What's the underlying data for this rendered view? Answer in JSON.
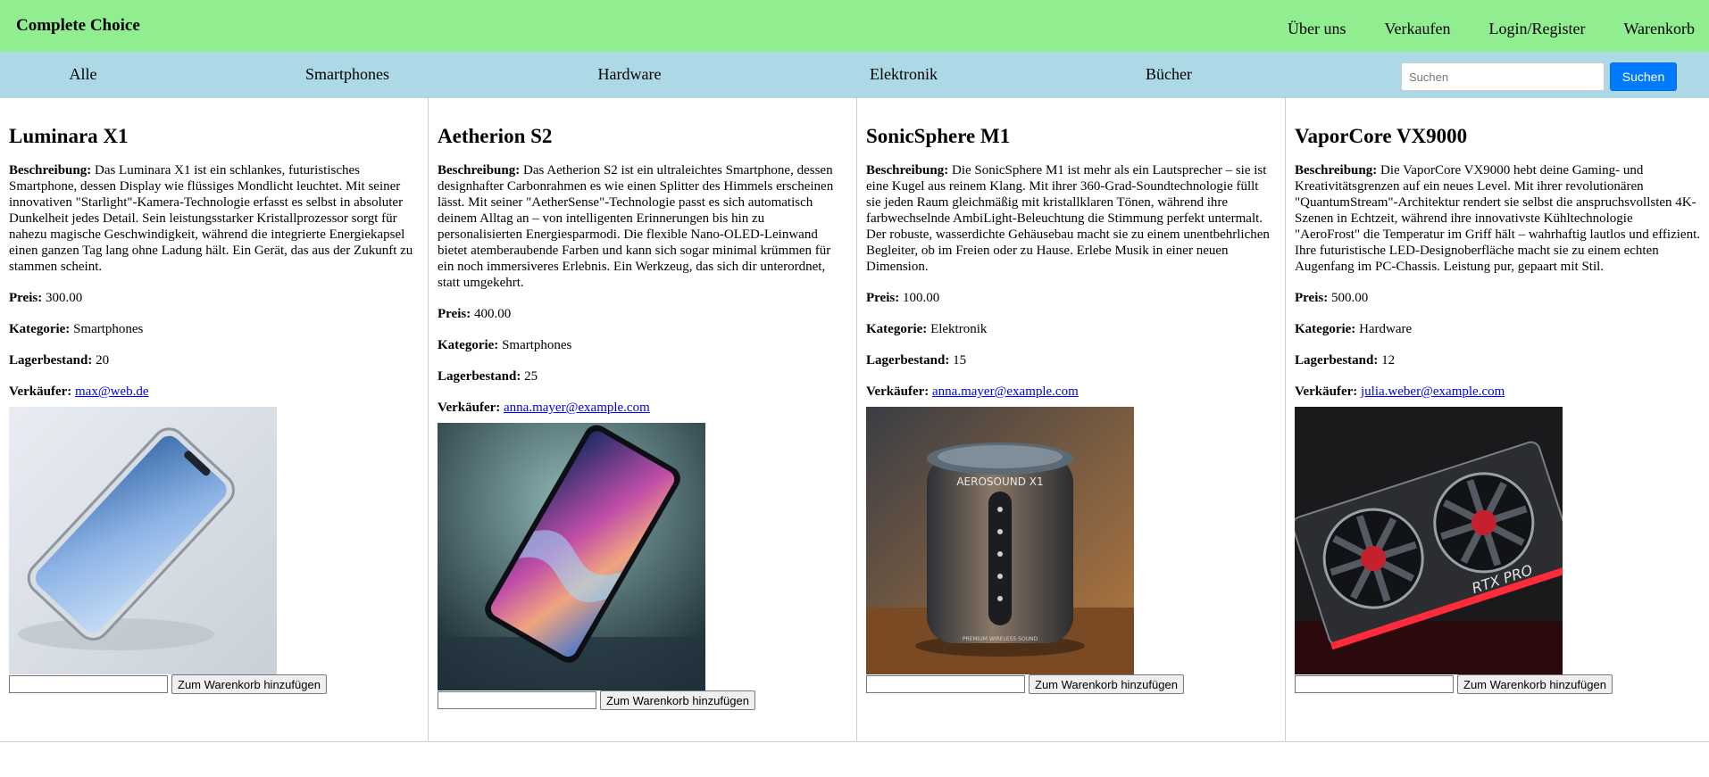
{
  "brand": "Complete Choice",
  "top_nav": [
    "Über uns",
    "Verkaufen",
    "Login/Register",
    "Warenkorb"
  ],
  "categories": [
    "Alle",
    "Smartphones",
    "Hardware",
    "Elektronik",
    "Bücher"
  ],
  "search": {
    "placeholder": "Suchen",
    "button": "Suchen"
  },
  "labels": {
    "description": "Beschreibung:",
    "price": "Preis:",
    "category": "Kategorie:",
    "stock": "Lagerbestand:",
    "seller": "Verkäufer:",
    "add_to_cart": "Zum Warenkorb hinzufügen"
  },
  "products": [
    {
      "name": "Luminara X1",
      "description": "Das Luminara X1 ist ein schlankes, futuristisches Smartphone, dessen Display wie flüssiges Mondlicht leuchtet. Mit seiner innovativen \"Starlight\"-Kamera-Technologie erfasst es selbst in absoluter Dunkelheit jedes Detail. Sein leistungsstarker Kristallprozessor sorgt für nahezu magische Geschwindigkeit, während die integrierte Energiekapsel einen ganzen Tag lang ohne Ladung hält. Ein Gerät, das aus der Zukunft zu stammen scheint.",
      "price": "300.00",
      "category": "Smartphones",
      "stock": "20",
      "seller": "max@web.de",
      "image": "smartphone-image",
      "qty": ""
    },
    {
      "name": "Aetherion S2",
      "description": "Das Aetherion S2 ist ein ultraleichtes Smartphone, dessen designhafter Carbonrahmen es wie einen Splitter des Himmels erscheinen lässt. Mit seiner \"AetherSense\"-Technologie passt es sich automatisch deinem Alltag an – von intelligenten Erinnerungen bis hin zu personalisierten Energiesparmodi. Die flexible Nano-OLED-Leinwand bietet atemberaubende Farben und kann sich sogar minimal krümmen für ein noch immersiveres Erlebnis. Ein Werkzeug, das sich dir unterordnet, statt umgekehrt.",
      "price": "400.00",
      "category": "Smartphones",
      "stock": "25",
      "seller": "anna.mayer@example.com",
      "image": "smartphone-image",
      "qty": ""
    },
    {
      "name": "SonicSphere M1",
      "description": "Die SonicSphere M1 ist mehr als ein Lautsprecher – sie ist eine Kugel aus reinem Klang. Mit ihrer 360-Grad-Soundtechnologie füllt sie jeden Raum gleichmäßig mit kristallklaren Tönen, während ihre farbwechselnde AmbiLight-Beleuchtung die Stimmung perfekt untermalt. Der robuste, wasserdichte Gehäusebau macht sie zu einem unentbehrlichen Begleiter, ob im Freien oder zu Hause. Erlebe Musik in einer neuen Dimension.",
      "price": "100.00",
      "category": "Elektronik",
      "stock": "15",
      "seller": "anna.mayer@example.com",
      "image": "speaker-image",
      "speaker_text": "AEROSOUND X1",
      "speaker_subtext": "PREMIUM WIRELESS SOUND",
      "qty": ""
    },
    {
      "name": "VaporCore VX9000",
      "description": "Die VaporCore VX9000 hebt deine Gaming- und Kreativitätsgrenzen auf ein neues Level. Mit ihrer revolutionären \"QuantumStream\"-Architektur rendert sie selbst die anspruchsvollsten 4K-Szenen in Echtzeit, während ihre innovativste Kühltechnologie \"AeroFrost\" die Temperatur im Griff hält – wahrhaftig lautlos und effizient. Ihre futuristische LED-Designoberfläche macht sie zu einem echten Augenfang im PC-Chassis. Leistung pur, gepaart mit Stil.",
      "price": "500.00",
      "category": "Hardware",
      "stock": "12",
      "seller": "julia.weber@example.com",
      "image": "graphics-card-image",
      "gpu_text": "RTX PRO",
      "qty": ""
    }
  ]
}
